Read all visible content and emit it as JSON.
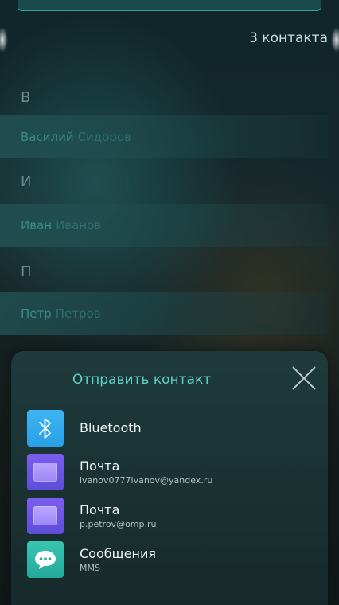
{
  "contact_count": "3 контакта",
  "sections": [
    {
      "letter": "В",
      "first": "Василий",
      "last": "Сидоров"
    },
    {
      "letter": "И",
      "first": "Иван",
      "last": "Иванов"
    },
    {
      "letter": "П",
      "first": "Петр",
      "last": "Петров"
    }
  ],
  "share_sheet": {
    "title": "Отправить контакт",
    "items": [
      {
        "icon": "bluetooth-icon",
        "title": "Bluetooth",
        "subtitle": ""
      },
      {
        "icon": "mail-icon",
        "title": "Почта",
        "subtitle": "ivanov0777ivanov@yandex.ru"
      },
      {
        "icon": "mail-icon",
        "title": "Почта",
        "subtitle": "p.petrov@omp.ru"
      },
      {
        "icon": "messages-icon",
        "title": "Сообщения",
        "subtitle": "MMS"
      }
    ]
  },
  "colors": {
    "accent": "#5fd0c8",
    "bluetooth": "#3fb4f4",
    "mail": "#6e56e8",
    "messages": "#2fb9a7"
  }
}
